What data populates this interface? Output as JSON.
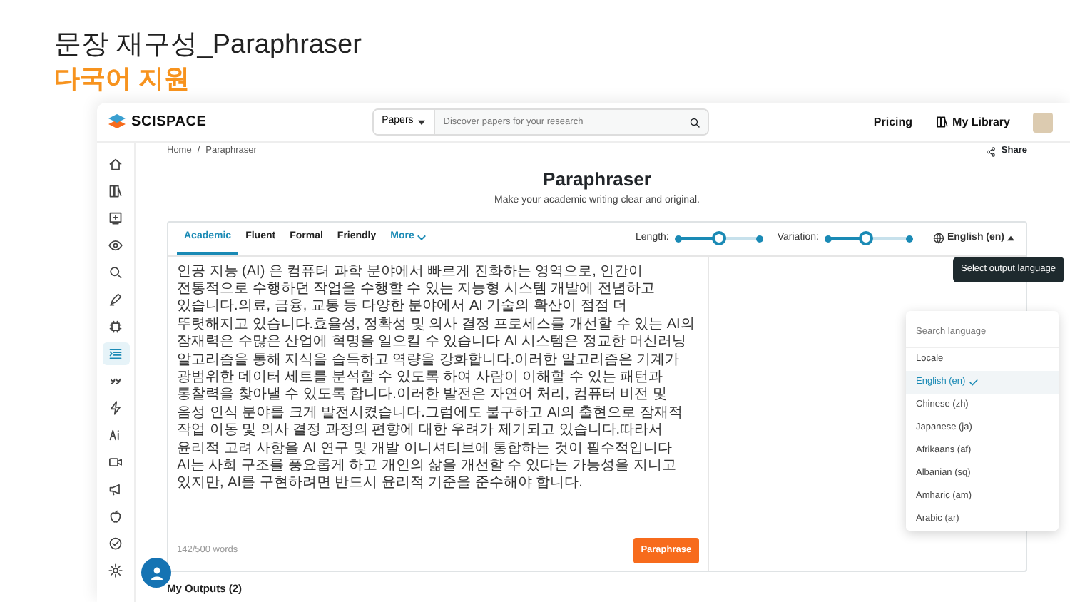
{
  "slide": {
    "title": "문장 재구성_Paraphraser",
    "subtitle": "다국어 지원"
  },
  "topbar": {
    "logo": "SCISPACE",
    "search_scope": "Papers",
    "search": {
      "placeholder": "Discover papers for your research"
    },
    "links": [
      "Pricing",
      "My Library"
    ]
  },
  "sidebar": {
    "items": [
      {
        "kind": "home",
        "selected": false
      },
      {
        "kind": "books",
        "selected": false
      },
      {
        "kind": "monitor",
        "selected": false
      },
      {
        "kind": "eye",
        "selected": false
      },
      {
        "kind": "search",
        "selected": false
      },
      {
        "kind": "pen",
        "selected": false
      },
      {
        "kind": "chip",
        "selected": false
      },
      {
        "kind": "list",
        "selected": true
      },
      {
        "kind": "quote",
        "selected": false
      },
      {
        "kind": "bolt",
        "selected": false
      },
      {
        "kind": "ai",
        "selected": false
      },
      {
        "kind": "video",
        "selected": false
      },
      {
        "kind": "megaphone",
        "selected": false
      },
      {
        "kind": "apple",
        "selected": false
      },
      {
        "kind": "badge",
        "selected": false
      },
      {
        "kind": "gear",
        "selected": false
      }
    ]
  },
  "breadcrumb": {
    "items": [
      "Home",
      "Paraphraser"
    ],
    "separator": "/"
  },
  "share": "Share",
  "page": {
    "title": "Paraphraser",
    "subtitle": "Make your academic writing clear and original."
  },
  "modes": [
    {
      "label": "Academic",
      "selected": true
    },
    {
      "label": "Fluent",
      "selected": false
    },
    {
      "label": "Formal",
      "selected": false
    },
    {
      "label": "Friendly",
      "selected": false
    },
    {
      "label": "More",
      "selected": false
    }
  ],
  "sliders": [
    {
      "label": "Length:",
      "level": 0.5
    },
    {
      "label": "Variation:",
      "level": 0.47
    }
  ],
  "language": {
    "label": "English (en)",
    "tooltip": "Select output language",
    "search": {
      "placeholder": "Search language"
    },
    "options": [
      {
        "label": "Locale",
        "selected": false
      },
      {
        "label": "English (en)",
        "selected": true
      },
      {
        "label": "Chinese (zh)",
        "selected": false
      },
      {
        "label": "Japanese (ja)",
        "selected": false
      },
      {
        "label": "Afrikaans (af)",
        "selected": false
      },
      {
        "label": "Albanian (sq)",
        "selected": false
      },
      {
        "label": "Amharic (am)",
        "selected": false
      },
      {
        "label": "Arabic (ar)",
        "selected": false
      }
    ]
  },
  "input": {
    "text": "인공 지능 (AI) 은 컴퓨터 과학 분야에서 빠르게 진화하는 영역으로, 인간이 전통적으로 수행하던 작업을 수행할 수 있는 지능형 시스템 개발에 전념하고 있습니다.의료, 금융, 교통 등 다양한 분야에서 AI 기술의 확산이 점점 더 뚜렷해지고 있습니다.효율성, 정확성 및 의사 결정 프로세스를 개선할 수 있는 AI의 잠재력은 수많은 산업에 혁명을 일으킬 수 있습니다 AI 시스템은 정교한 머신러닝 알고리즘을 통해 지식을 습득하고 역량을 강화합니다.이러한 알고리즘은 기계가 광범위한 데이터 세트를 분석할 수 있도록 하여 사람이 이해할 수 있는 패턴과 통찰력을 찾아낼 수 있도록 합니다.이러한 발전은 자연어 처리, 컴퓨터 비전 및 음성 인식 분야를 크게 발전시켰습니다.그럼에도 불구하고 AI의 출현으로 잠재적 작업 이동 및 의사 결정 과정의 편향에 대한 우려가 제기되고 있습니다.따라서 윤리적 고려 사항을 AI 연구 및 개발 이니셔티브에 통합하는 것이 필수적입니다 AI는 사회 구조를 풍요롭게 하고 개인의 삶을 개선할 수 있다는 가능성을 지니고 있지만, AI를 구현하려면 반드시 윤리적 기준을 준수해야 합니다.",
    "word_count": "142/500 words",
    "button": "Paraphrase"
  },
  "outputs_heading": "My Outputs (2)"
}
